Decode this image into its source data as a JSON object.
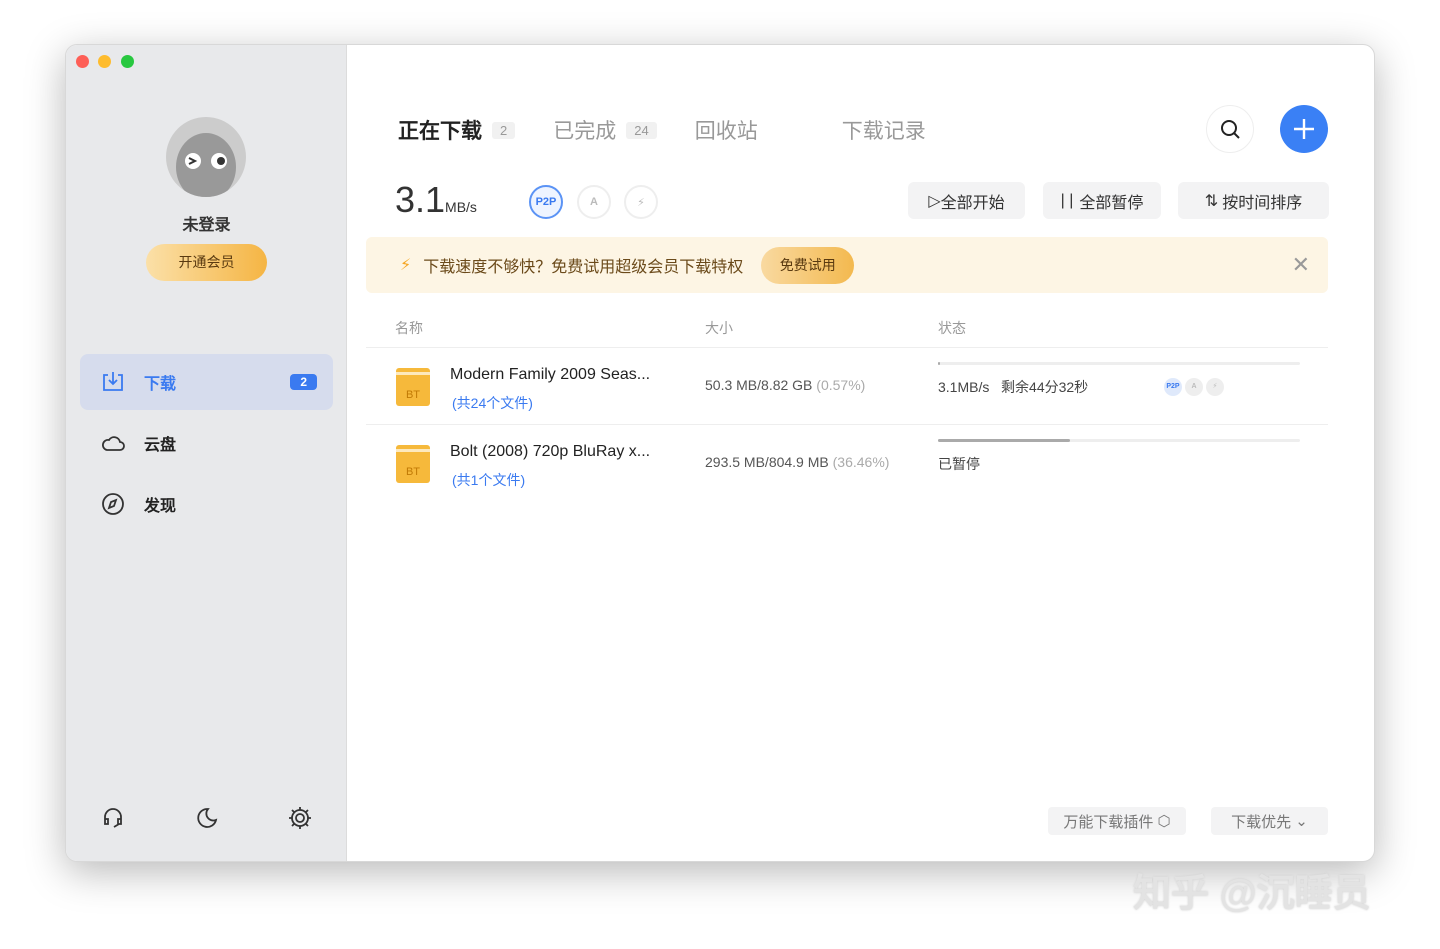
{
  "sidebar": {
    "user": "未登录",
    "vip": "开通会员",
    "nav": [
      {
        "label": "下载",
        "badge": "2"
      },
      {
        "label": "云盘"
      },
      {
        "label": "发现"
      }
    ]
  },
  "tabs": [
    {
      "label": "正在下载",
      "count": "2"
    },
    {
      "label": "已完成",
      "count": "24"
    },
    {
      "label": "回收站"
    },
    {
      "label": "下载记录"
    }
  ],
  "speed": {
    "value": "3.1",
    "unit": "MB/s"
  },
  "modes": [
    "P2P",
    "A",
    "⚡"
  ],
  "toolbar": {
    "start_all": "全部开始",
    "pause_all": "全部暂停",
    "sort": "按时间排序"
  },
  "banner": {
    "text": "下载速度不够快？免费试用超级会员下载特权",
    "trial": "免费试用"
  },
  "columns": {
    "name": "名称",
    "size": "大小",
    "status": "状态"
  },
  "downloads": [
    {
      "name": "Modern Family 2009 Seas...",
      "files": "(共24个文件)",
      "size": "50.3 MB/8.82 GB",
      "pct": "(0.57%)",
      "progress": 0.57,
      "speed": "3.1MB/s",
      "remaining": "剩余44分32秒",
      "type": "BT"
    },
    {
      "name": "Bolt (2008) 720p BluRay x...",
      "files": "(共1个文件)",
      "size": "293.5 MB/804.9 MB",
      "pct": "(36.46%)",
      "progress": 36.46,
      "status": "已暂停",
      "type": "BT"
    }
  ],
  "footer": {
    "plugin": "万能下载插件",
    "priority": "下载优先"
  },
  "watermark": "知乎 @沉睡员"
}
